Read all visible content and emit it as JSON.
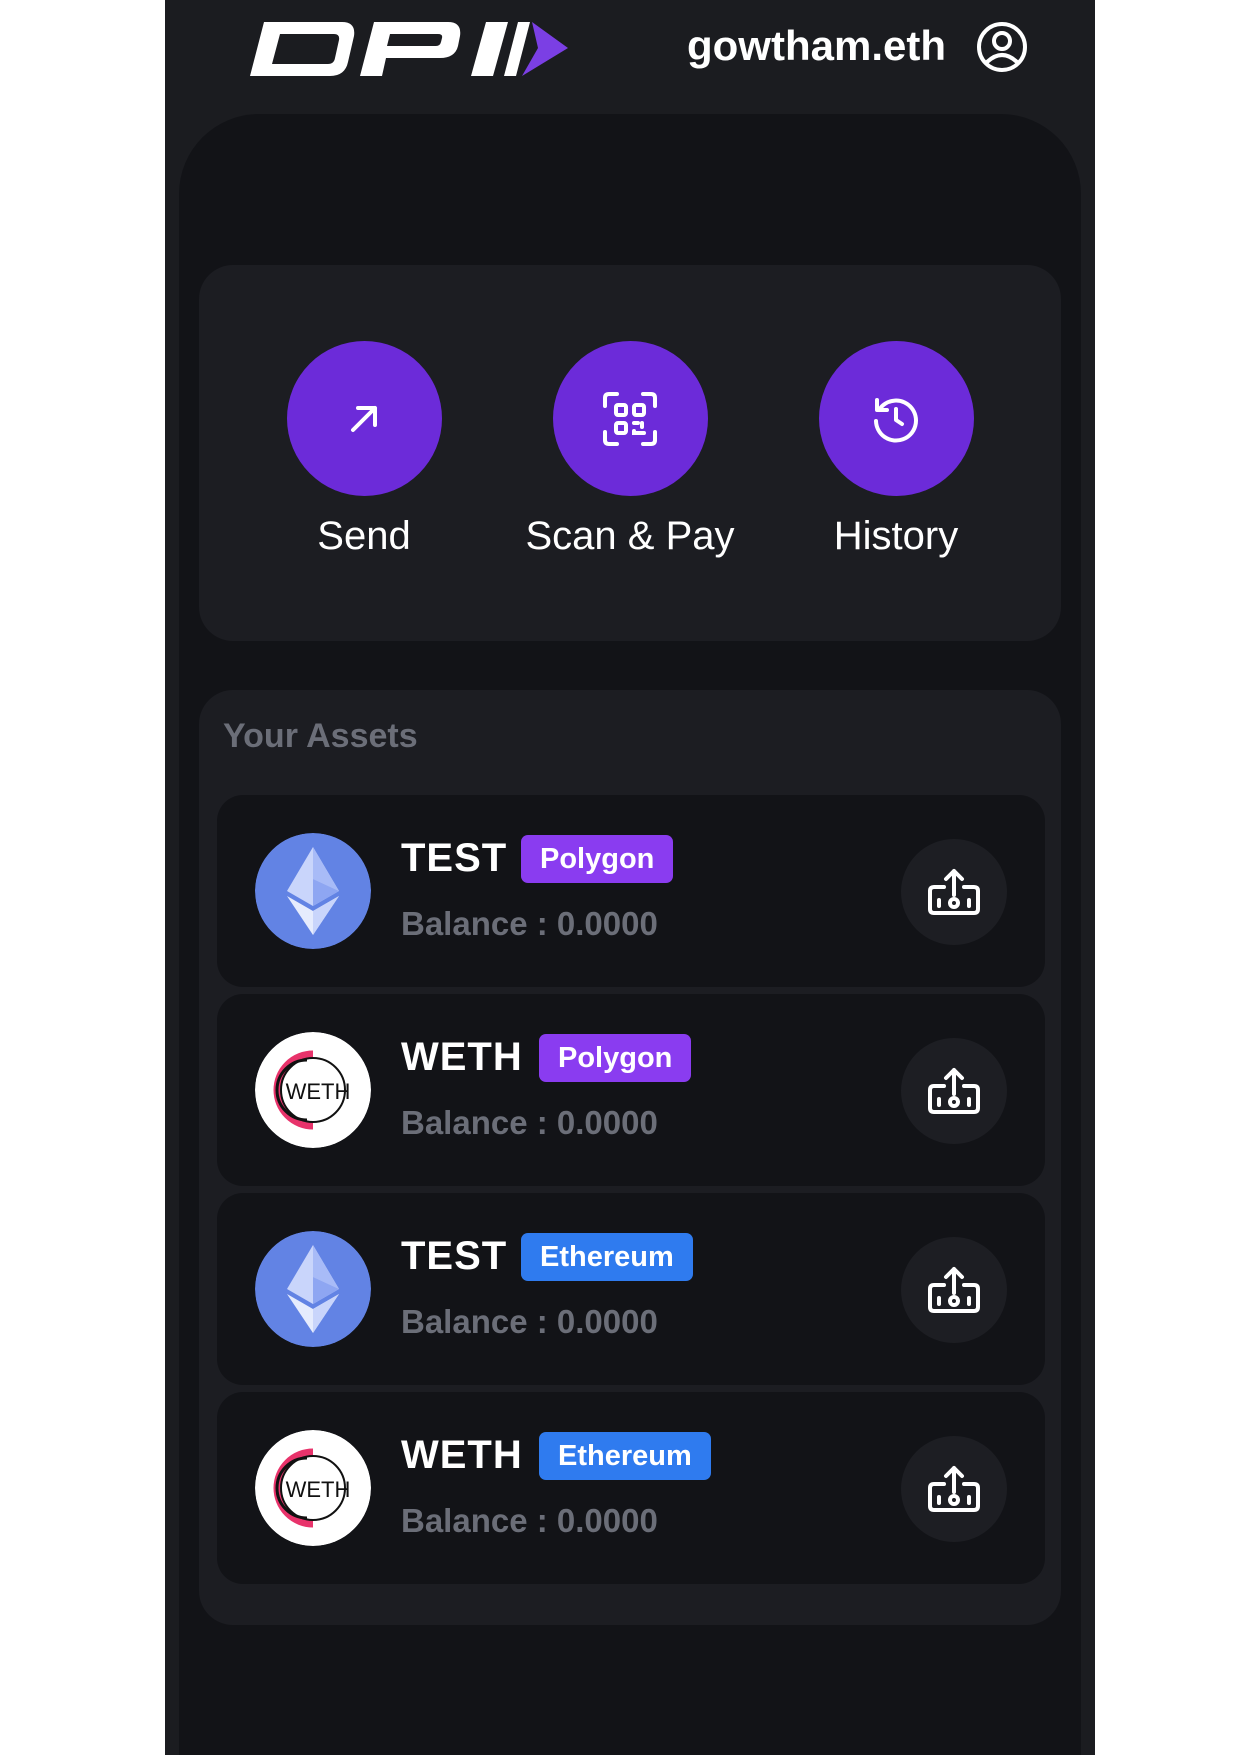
{
  "header": {
    "logo_text": "DPI",
    "username": "gowtham.eth",
    "profile_icon": "user-circle-icon"
  },
  "actions": [
    {
      "label": "Send",
      "icon": "arrow-up-right-icon"
    },
    {
      "label": "Scan & Pay",
      "icon": "qr-scan-icon"
    },
    {
      "label": "History",
      "icon": "history-icon"
    }
  ],
  "assets": {
    "title": "Your Assets",
    "items": [
      {
        "token": "TEST",
        "chain": "Polygon",
        "balance": "Balance : 0.0000",
        "logo": "ethereum-logo"
      },
      {
        "token": "WETH",
        "chain": "Polygon",
        "balance": "Balance : 0.0000",
        "logo": "weth-logo"
      },
      {
        "token": "TEST",
        "chain": "Ethereum",
        "balance": "Balance : 0.0000",
        "logo": "ethereum-logo"
      },
      {
        "token": "WETH",
        "chain": "Ethereum",
        "balance": "Balance : 0.0000",
        "logo": "weth-logo"
      }
    ],
    "action_icon": "deposit-icon"
  },
  "colors": {
    "accent_purple": "#6c2bd9",
    "polygon_badge": "#8a3cf0",
    "ethereum_badge": "#2f7bef",
    "eth_logo_bg": "#6283e4",
    "background": "#1b1c20",
    "panel": "#121317",
    "card": "#1c1d22",
    "muted_text": "#6b6e78"
  }
}
